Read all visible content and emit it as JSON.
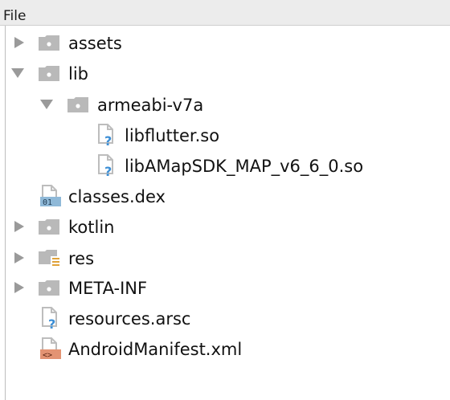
{
  "header": {
    "title": "File"
  },
  "tree": {
    "items": [
      {
        "label": "assets",
        "type": "folder",
        "state": "collapsed",
        "depth": 0
      },
      {
        "label": "lib",
        "type": "folder",
        "state": "expanded",
        "depth": 0
      },
      {
        "label": "armeabi-v7a",
        "type": "folder",
        "state": "expanded",
        "depth": 1
      },
      {
        "label": "libflutter.so",
        "type": "unknown-file",
        "depth": 2
      },
      {
        "label": "libAMapSDK_MAP_v6_6_0.so",
        "type": "unknown-file",
        "depth": 2
      },
      {
        "label": "classes.dex",
        "type": "dex-file",
        "depth": 0
      },
      {
        "label": "kotlin",
        "type": "folder",
        "state": "collapsed",
        "depth": 0
      },
      {
        "label": "res",
        "type": "resource-folder",
        "state": "collapsed",
        "depth": 0
      },
      {
        "label": "META-INF",
        "type": "folder",
        "state": "collapsed",
        "depth": 0
      },
      {
        "label": "resources.arsc",
        "type": "unknown-file",
        "depth": 0
      },
      {
        "label": "AndroidManifest.xml",
        "type": "xml-file",
        "depth": 0
      }
    ]
  },
  "icons": {
    "folder": "folder-icon",
    "unknown_file": "unknown-file-icon",
    "dex_file": "dex-file-icon",
    "resource_folder": "resource-folder-icon",
    "xml_file": "xml-file-icon",
    "expanded": "chevron-down-icon",
    "collapsed": "chevron-right-icon"
  },
  "badges": {
    "dex": "01",
    "xml": "<>",
    "unknown": "?"
  },
  "colors": {
    "folder": "#b9b9b9",
    "folder_dot": "#ffffff",
    "arrow": "#9a9a9a",
    "page": "#c8c8c8",
    "question": "#3d8fd6",
    "dex_strip": "#8fb9d8",
    "xml_strip": "#e39373",
    "res_lines": "#e0a23a"
  }
}
